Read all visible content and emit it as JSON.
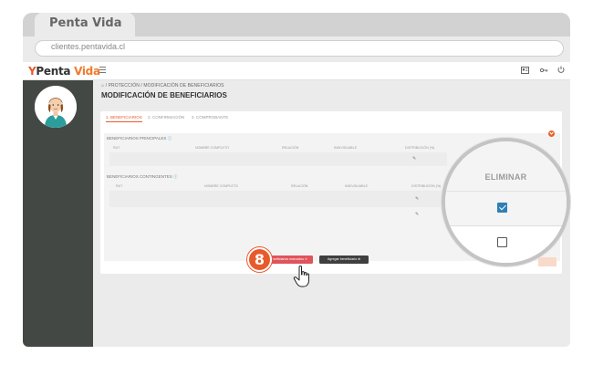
{
  "browser": {
    "tab_title": "Penta Vida",
    "url": "clientes.pentavida.cl"
  },
  "header": {
    "logo_mark": "Y",
    "logo_text_a": "Penta ",
    "logo_text_b": "Vida",
    "icons": [
      "id-card-icon",
      "key-icon",
      "power-icon"
    ]
  },
  "page": {
    "breadcrumb": "⌂ / PROTECCIÓN / MODIFICACIÓN DE BENEFICIARIOS",
    "title": "MODIFICACIÓN DE BENEFICIARIOS"
  },
  "steps": [
    {
      "label": "1. BENEFICIARIOS",
      "active": true
    },
    {
      "label": "2. CONFIRMACIÓN",
      "active": false
    },
    {
      "label": "3. COMPROBANTE",
      "active": false
    }
  ],
  "principales": {
    "label": "BENEFICIARIOS PRINCIPALES",
    "columns": [
      "RUT",
      "NOMBRE COMPLETO",
      "RELACIÓN",
      "INDIVIDUABLE",
      "DISTRIBUCIÓN (%)"
    ]
  },
  "contingentes": {
    "label": "BENEFICIARIOS CONTINGENTES",
    "columns": [
      "RUT",
      "NOMBRE COMPLETO",
      "RELACIÓN",
      "INDIVIDUABLE",
      "DISTRIBUCIÓN (%)"
    ]
  },
  "buttons": {
    "eliminar_marcados": "Eliminar beneficiarios marcados ✕",
    "agregar": "Agregar beneficiario ⊕"
  },
  "step_badge": "8",
  "magnifier": {
    "column_header": "ELIMINAR",
    "rows": [
      {
        "checked": true
      },
      {
        "checked": false
      }
    ]
  },
  "colors": {
    "accent": "#e85a2b",
    "delete_button": "#e0545b",
    "add_button": "#3f3f3f",
    "sidebar": "#444845",
    "checkbox": "#2e7fb5"
  }
}
